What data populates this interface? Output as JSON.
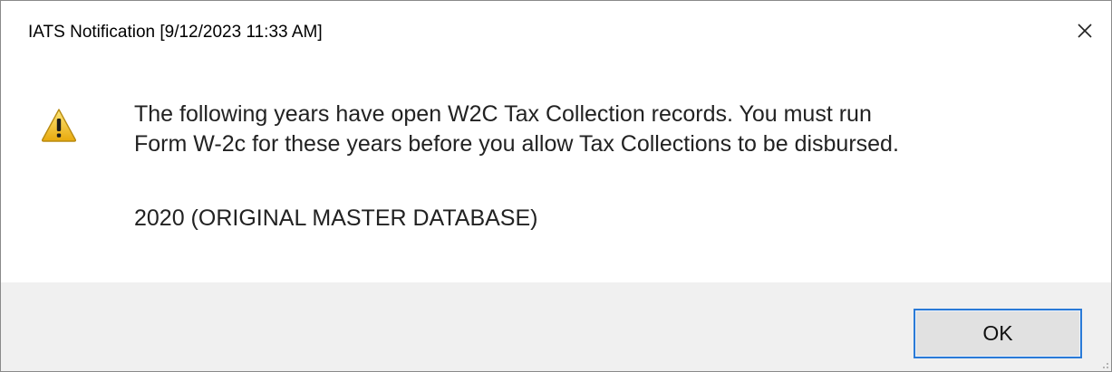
{
  "dialog": {
    "title": "IATS Notification [9/12/2023 11:33 AM]",
    "message_lines": [
      "The following years have open W2C Tax Collection records.  You must run",
      "Form W-2c for these years before you allow Tax Collections to be disbursed."
    ],
    "items": [
      "2020 (ORIGINAL MASTER DATABASE)"
    ],
    "ok_label": "OK",
    "icons": {
      "message": "warning-icon",
      "close": "close-icon"
    }
  },
  "colors": {
    "warning_fill": "#f5c518",
    "button_border": "#2a7ad7",
    "footer_bg": "#f0f0f0"
  }
}
